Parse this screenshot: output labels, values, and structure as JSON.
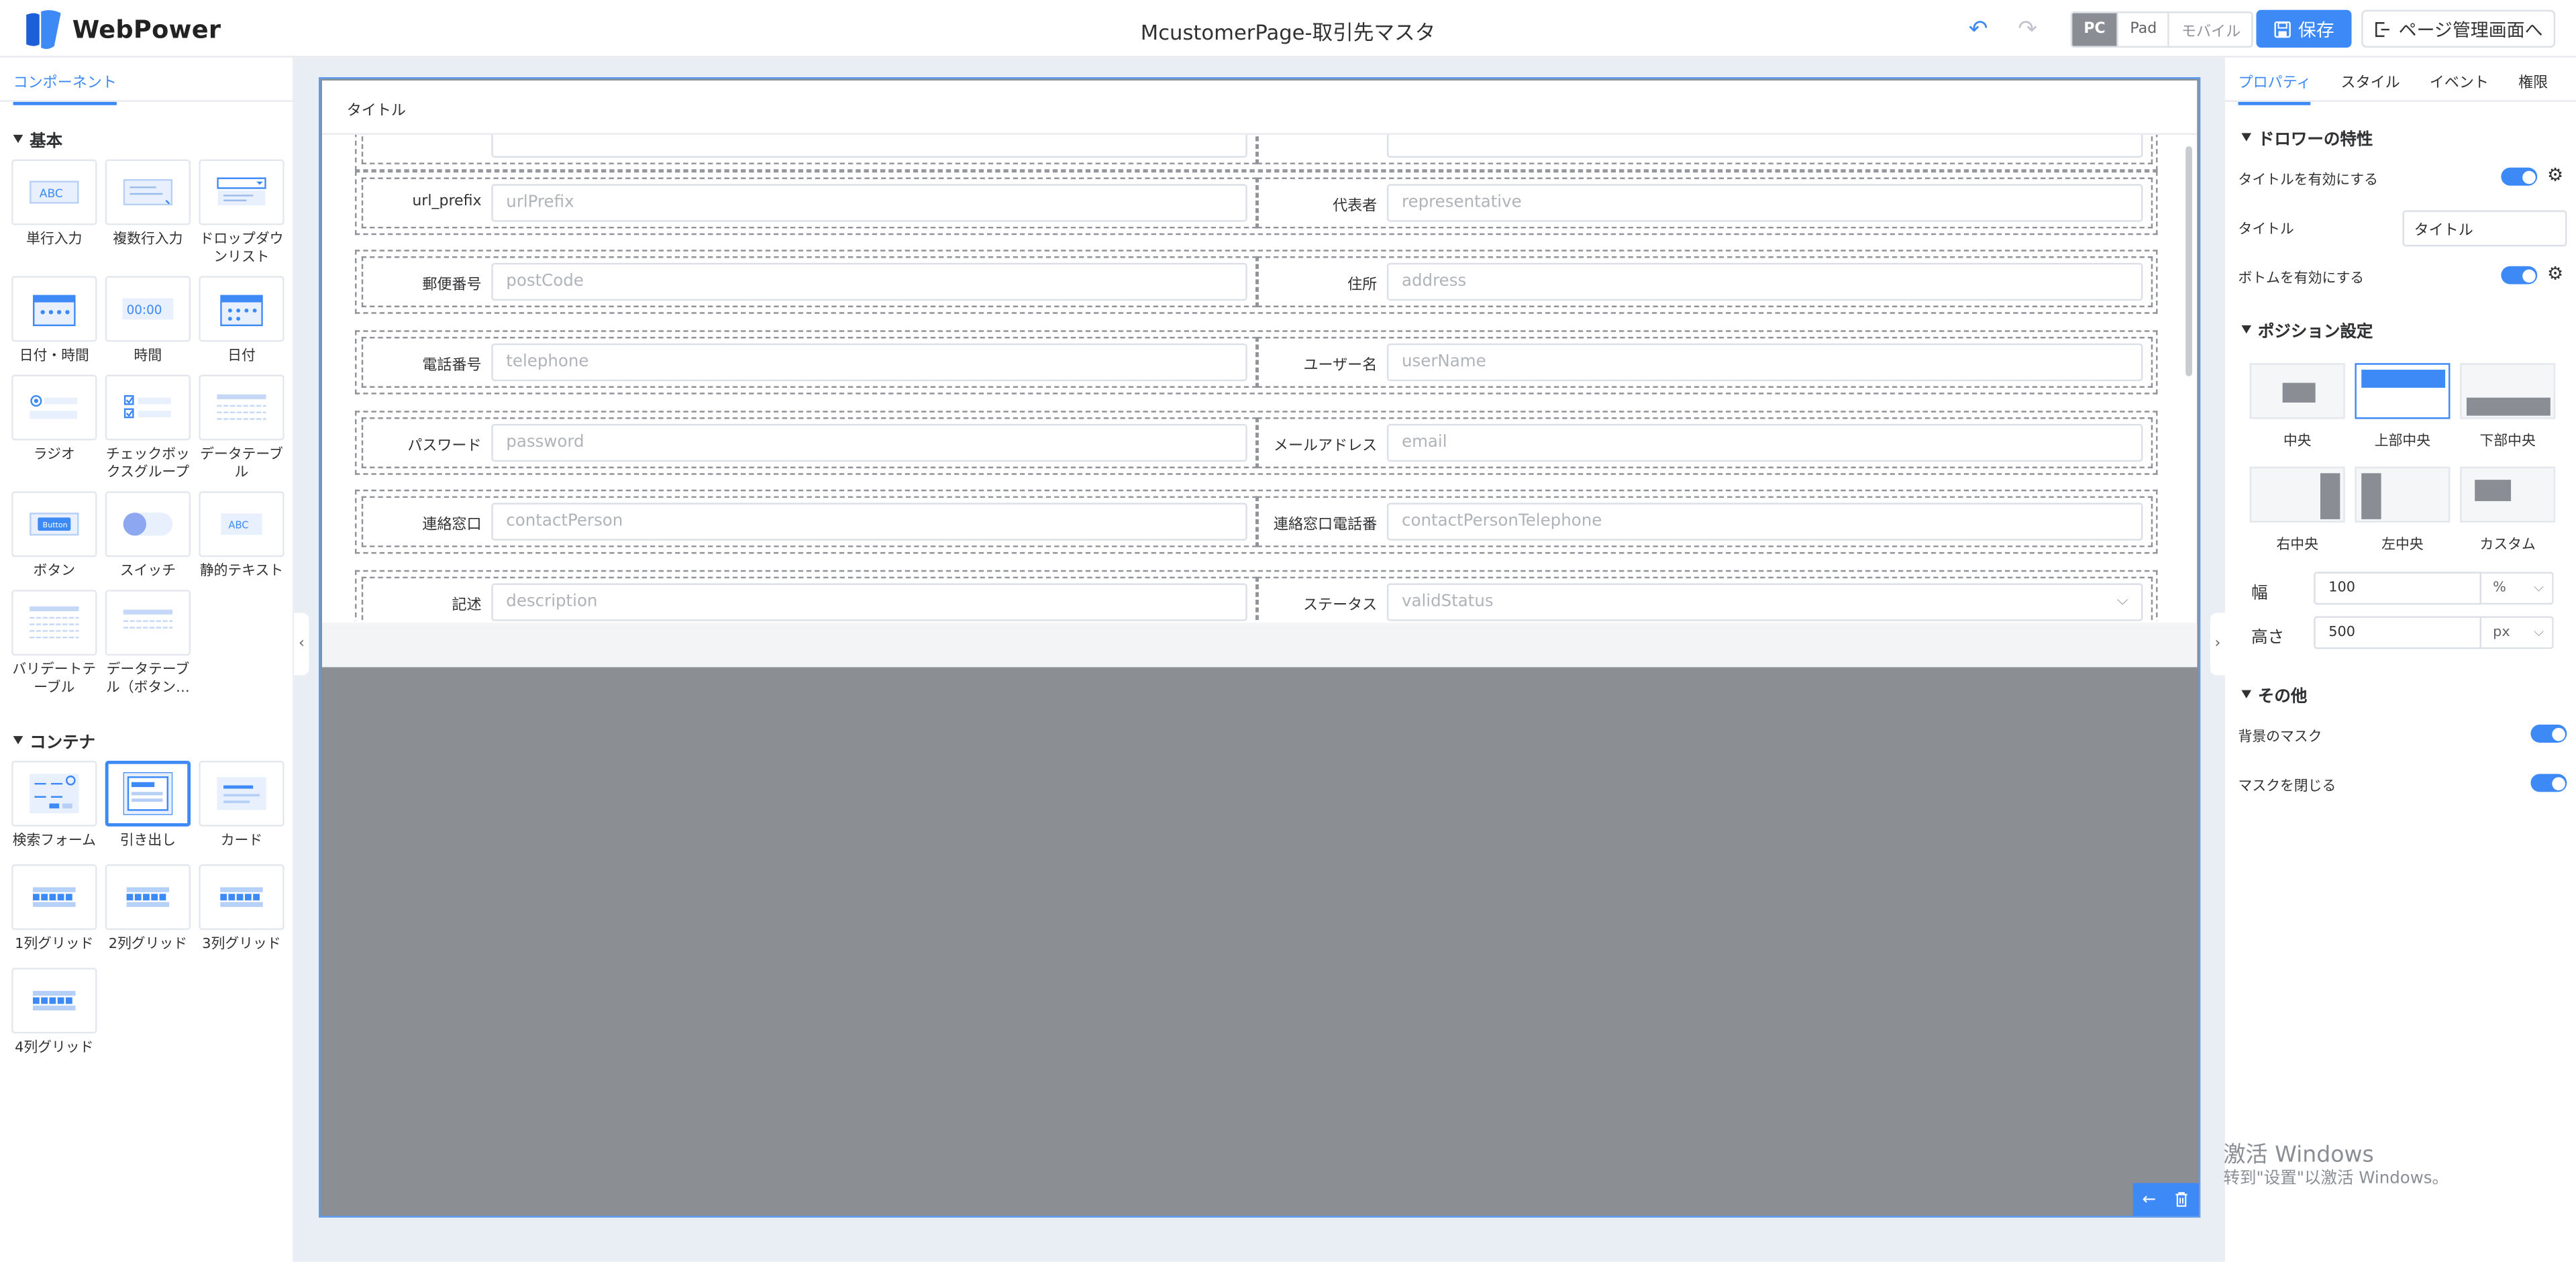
{
  "header": {
    "app_name": "WebPower",
    "page_title": "McustomerPage-取引先マスタ",
    "devices": [
      "PC",
      "Pad",
      "モバイル"
    ],
    "active_device": "PC",
    "save_label": "保存",
    "page_mgmt_label": "ページ管理画面へ"
  },
  "left_panel": {
    "tab": "コンポーネント",
    "sections": [
      {
        "title": "基本",
        "items": [
          "単行入力",
          "複数行入力",
          "ドロップダウンリスト",
          "日付・時間",
          "時間",
          "日付",
          "ラジオ",
          "チェックボックスグループ",
          "データテーブル",
          "ボタン",
          "スイッチ",
          "静的テキスト",
          "バリデートテーブル",
          "データテーブル（ボタン…"
        ]
      },
      {
        "title": "コンテナ",
        "items": [
          "検索フォーム",
          "引き出し",
          "カード",
          "1列グリッド",
          "2列グリッド",
          "3列グリッド",
          "4列グリッド"
        ]
      }
    ],
    "icon_texts": {
      "input": "ABC",
      "time": "00:00",
      "button": "Button",
      "static": "ABC"
    }
  },
  "drawer": {
    "title": "タイトル",
    "rows": [
      [
        {
          "label": "",
          "placeholder": ""
        },
        {
          "label": "",
          "placeholder": ""
        }
      ],
      [
        {
          "label": "url_prefix",
          "placeholder": "urlPrefix"
        },
        {
          "label": "代表者",
          "placeholder": "representative"
        }
      ],
      [
        {
          "label": "郵便番号",
          "placeholder": "postCode"
        },
        {
          "label": "住所",
          "placeholder": "address"
        }
      ],
      [
        {
          "label": "電話番号",
          "placeholder": "telephone"
        },
        {
          "label": "ユーザー名",
          "placeholder": "userName"
        }
      ],
      [
        {
          "label": "パスワード",
          "placeholder": "password"
        },
        {
          "label": "メールアドレス",
          "placeholder": "email"
        }
      ],
      [
        {
          "label": "連絡窓口",
          "placeholder": "contactPerson"
        },
        {
          "label": "連絡窓口電話番",
          "placeholder": "contactPersonTelephone"
        }
      ],
      [
        {
          "label": "記述",
          "placeholder": "description"
        },
        {
          "label": "ステータス",
          "placeholder": "validStatus",
          "select": true
        }
      ]
    ]
  },
  "right_panel": {
    "tabs": [
      "プロパティ",
      "スタイル",
      "イベント",
      "権限"
    ],
    "active_tab": "プロパティ",
    "drawer_props": {
      "section": "ドロワーの特性",
      "enable_title": "タイトルを有効にする",
      "title_label": "タイトル",
      "title_value": "タイトル",
      "enable_bottom": "ボトムを有効にする"
    },
    "position": {
      "section": "ポジション設定",
      "options": [
        "中央",
        "上部中央",
        "下部中央",
        "右中央",
        "左中央",
        "カスタム"
      ],
      "selected": "上部中央",
      "width_label": "幅",
      "width_value": "100",
      "width_unit": "%",
      "height_label": "高さ",
      "height_value": "500",
      "height_unit": "px"
    },
    "other": {
      "section": "その他",
      "bg_mask": "背景のマスク",
      "close_mask": "マスクを閉じる"
    }
  },
  "watermark": {
    "line1": "激活 Windows",
    "line2": "转到\"设置\"以激活 Windows。"
  },
  "colors": {
    "accent": "#3d8af7",
    "mask": "#8b8e93",
    "canvas_bg": "#e9eef5"
  }
}
